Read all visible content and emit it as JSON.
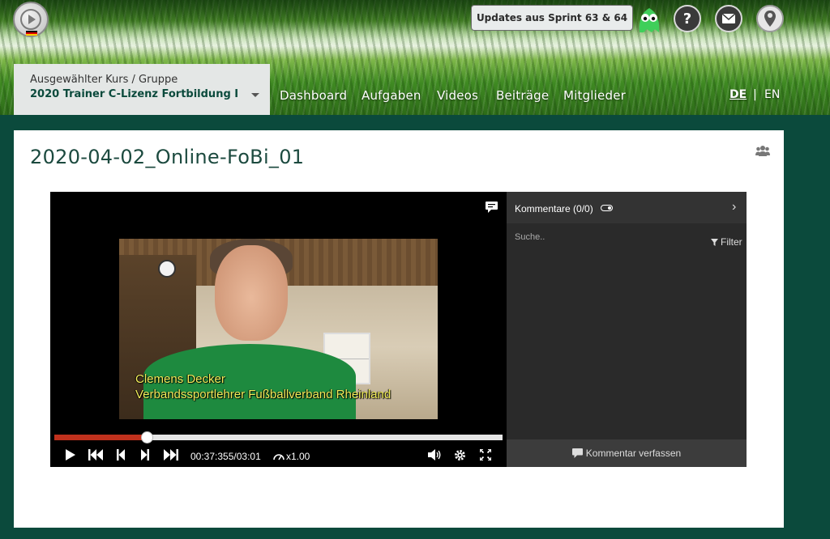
{
  "header": {
    "updates_label": "Updates aus Sprint 63 & 64",
    "help_icon_glyph": "?",
    "icons": [
      "logo-icon",
      "mascot-icon",
      "help-icon",
      "mail-icon",
      "profile-pin-icon"
    ]
  },
  "course": {
    "label": "Ausgewählter Kurs / Gruppe",
    "name": "2020 Trainer C-Lizenz Fortbildung I"
  },
  "nav": {
    "items": [
      {
        "label": "Dashboard"
      },
      {
        "label": "Aufgaben"
      },
      {
        "label": "Videos"
      },
      {
        "label": "Beiträge"
      },
      {
        "label": "Mitglieder"
      }
    ]
  },
  "lang": {
    "de": "DE",
    "sep": "|",
    "en": "EN"
  },
  "page": {
    "title": "2020-04-02_Online-FoBi_01"
  },
  "player": {
    "subtitle_line1": "Clemens Decker",
    "subtitle_line2": "Verbandssportlehrer Fußballverband Rheinland",
    "time": "00:37:355/03:01",
    "speed": "x1.00",
    "progress": 0.207
  },
  "comments": {
    "title": "Kommentare (0/0)",
    "search_placeholder": "Suche..",
    "filter_label": "Filter",
    "compose_label": "Kommentar verfassen"
  },
  "colors": {
    "brand_green": "#0b4a3c",
    "progress_red": "#c0311d",
    "subtitle_yellow": "#f3ee5a"
  }
}
